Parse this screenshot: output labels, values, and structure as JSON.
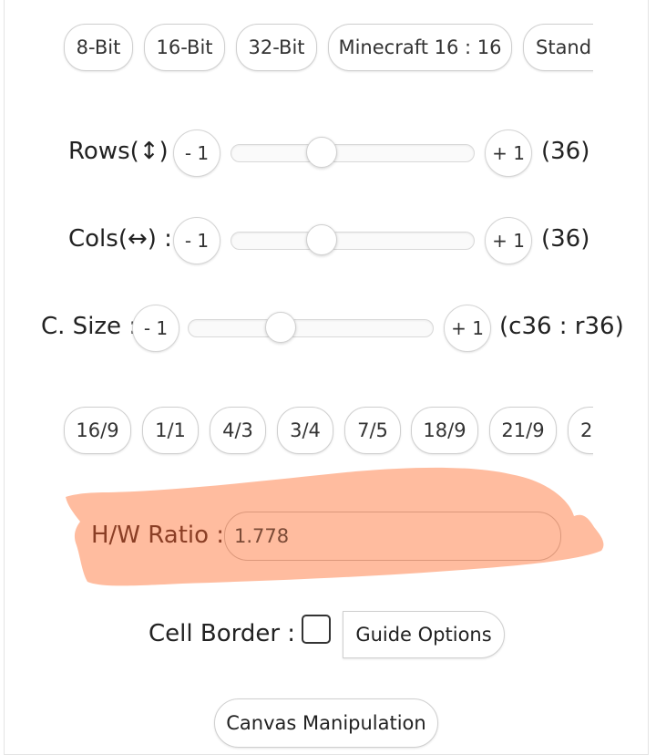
{
  "presets": [
    "8-Bit",
    "16-Bit",
    "32-Bit",
    "Minecraft 16 : 16",
    "Stand"
  ],
  "rows": {
    "label": "Rows(↕) :",
    "minus": "- 1",
    "plus": "+ 1",
    "count": "(36)",
    "slider_fraction": 0.37
  },
  "cols": {
    "label": "Cols(↔) :",
    "minus": "- 1",
    "plus": "+ 1",
    "count": "(36)",
    "slider_fraction": 0.37
  },
  "csize": {
    "label": "C. Size :",
    "minus": "- 1",
    "plus": "+ 1",
    "count": "(c36 : r36)",
    "slider_fraction": 0.37
  },
  "ratios": [
    "16/9",
    "1/1",
    "4/3",
    "3/4",
    "7/5",
    "18/9",
    "21/9",
    "2"
  ],
  "hw_ratio": {
    "label": "H/W Ratio :",
    "value": "1.778"
  },
  "cell_border": {
    "label": "Cell Border :",
    "checked": false
  },
  "guide_options_label": "Guide Options",
  "canvas_manipulation_label": "Canvas Manipulation",
  "colors": {
    "highlight": "#ffb89a",
    "highlight_text": "#8a3e25"
  },
  "icons": {
    "up_down_arrow": "↕",
    "left_right_arrow": "↔"
  }
}
